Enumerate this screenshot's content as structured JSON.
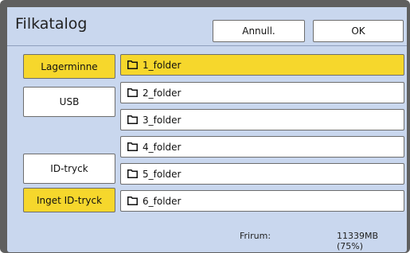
{
  "dialog": {
    "title": "Filkatalog",
    "cancel_label": "Annull.",
    "ok_label": "OK"
  },
  "storage": {
    "internal_label": "Lagerminne",
    "usb_label": "USB"
  },
  "id_options": {
    "id_print_label": "ID-tryck",
    "no_id_print_label": "Inget ID-tryck"
  },
  "folders": [
    {
      "name": "1_folder",
      "icon": "folder-icon",
      "selected": true
    },
    {
      "name": "2_folder",
      "icon": "folder-icon",
      "selected": false
    },
    {
      "name": "3_folder",
      "icon": "folder-icon",
      "selected": false
    },
    {
      "name": "4_folder",
      "icon": "folder-icon",
      "selected": false
    },
    {
      "name": "5_folder",
      "icon": "folder-icon",
      "selected": false
    },
    {
      "name": "6_folder",
      "icon": "folder-icon",
      "selected": false
    }
  ],
  "footer": {
    "free_label": "Frirum:",
    "free_value": "11339MB (75%)"
  },
  "colors": {
    "panel": "#c9d7ee",
    "selected": "#f6d72c",
    "frame": "#5f5f5f"
  }
}
